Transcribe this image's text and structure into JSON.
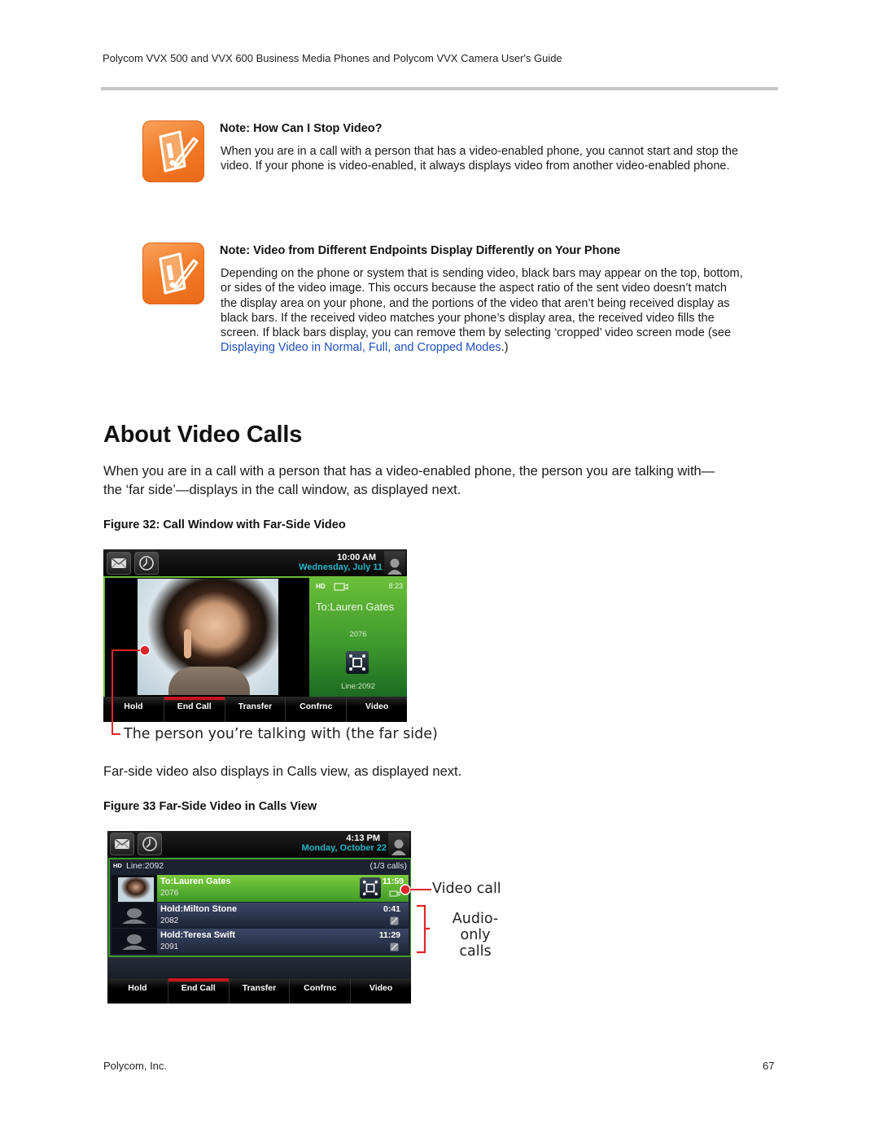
{
  "header": {
    "running_title": "Polycom VVX 500 and VVX 600 Business Media Phones and Polycom VVX Camera User's Guide"
  },
  "notes": [
    {
      "icon": "note-pencil-exclamation-icon",
      "title": "Note: How Can I Stop Video?",
      "lines": [
        "When you are in a call with a person that has a video-enabled phone, you cannot start and stop the",
        "video. If your phone is video-enabled, it always displays video from another video-enabled phone."
      ]
    },
    {
      "icon": "note-pencil-exclamation-icon",
      "title": "Note: Video from Different Endpoints Display Differently on Your Phone",
      "lines": [
        "Depending on the phone or system that is sending video, black bars may appear on the top, bottom,",
        "or sides of the video image. This occurs because the aspect ratio of the sent video doesn’t match",
        "the display area on your phone, and the portions of the video that aren’t being received display as",
        "black bars. If the received video matches your phone’s display area, the received video fills the",
        "screen. If black bars display, you can remove them by selecting ‘cropped’ video screen mode (see"
      ],
      "link_text": "Displaying Video in Normal, Full, and Cropped Modes",
      "after_link": ".)"
    }
  ],
  "section": {
    "heading": "About Video Calls",
    "intro_lines": [
      "When you are in a call with a person that has a video-enabled phone, the person you are talking with—",
      "the ‘far side’—displays in the call window, as displayed next."
    ],
    "second_para": "Far-side video also displays in Calls view, as displayed next."
  },
  "figure32": {
    "caption": "Figure 32: Call Window with Far-Side Video",
    "status_time": "10:00 AM",
    "status_date": "Wednesday, July 11",
    "hd_label": "HD",
    "duration": "8:23",
    "call_to": "To:Lauren Gates",
    "call_number": "2076",
    "line": "Line:2092",
    "softkeys": [
      "Hold",
      "End Call",
      "Transfer",
      "Confrnc",
      "Video"
    ],
    "active_softkey": "End Call",
    "annotation": "The person you’re talking with (the far side)"
  },
  "figure33": {
    "caption": "Figure 33 Far-Side Video in Calls View",
    "status_time": "4:13 PM",
    "status_date": "Monday, October 22",
    "hd_label": "HD",
    "line": "Line:2092",
    "call_count": "(1/3 calls)",
    "calls": [
      {
        "name": "To:Lauren Gates",
        "number": "2076",
        "time": "11:59",
        "type": "video"
      },
      {
        "name": "Hold:Milton Stone",
        "number": "2082",
        "time": "0:41",
        "type": "audio"
      },
      {
        "name": "Hold:Teresa Swift",
        "number": "2091",
        "time": "11:29",
        "type": "audio"
      }
    ],
    "softkeys": [
      "Hold",
      "End Call",
      "Transfer",
      "Confrnc",
      "Video"
    ],
    "active_softkey": "End Call",
    "annotation_video": "Video call",
    "annotation_audio_line1": "Audio-only",
    "annotation_audio_line2": "calls"
  },
  "colors": {
    "note_orange": "#f37d2a",
    "link_blue": "#1f4fbf",
    "phone_green": "#4fa82f",
    "date_cyan": "#23b4c8",
    "annotation_red": "#e0242c"
  },
  "footer": {
    "company": "Polycom, Inc.",
    "page_number": "67"
  }
}
